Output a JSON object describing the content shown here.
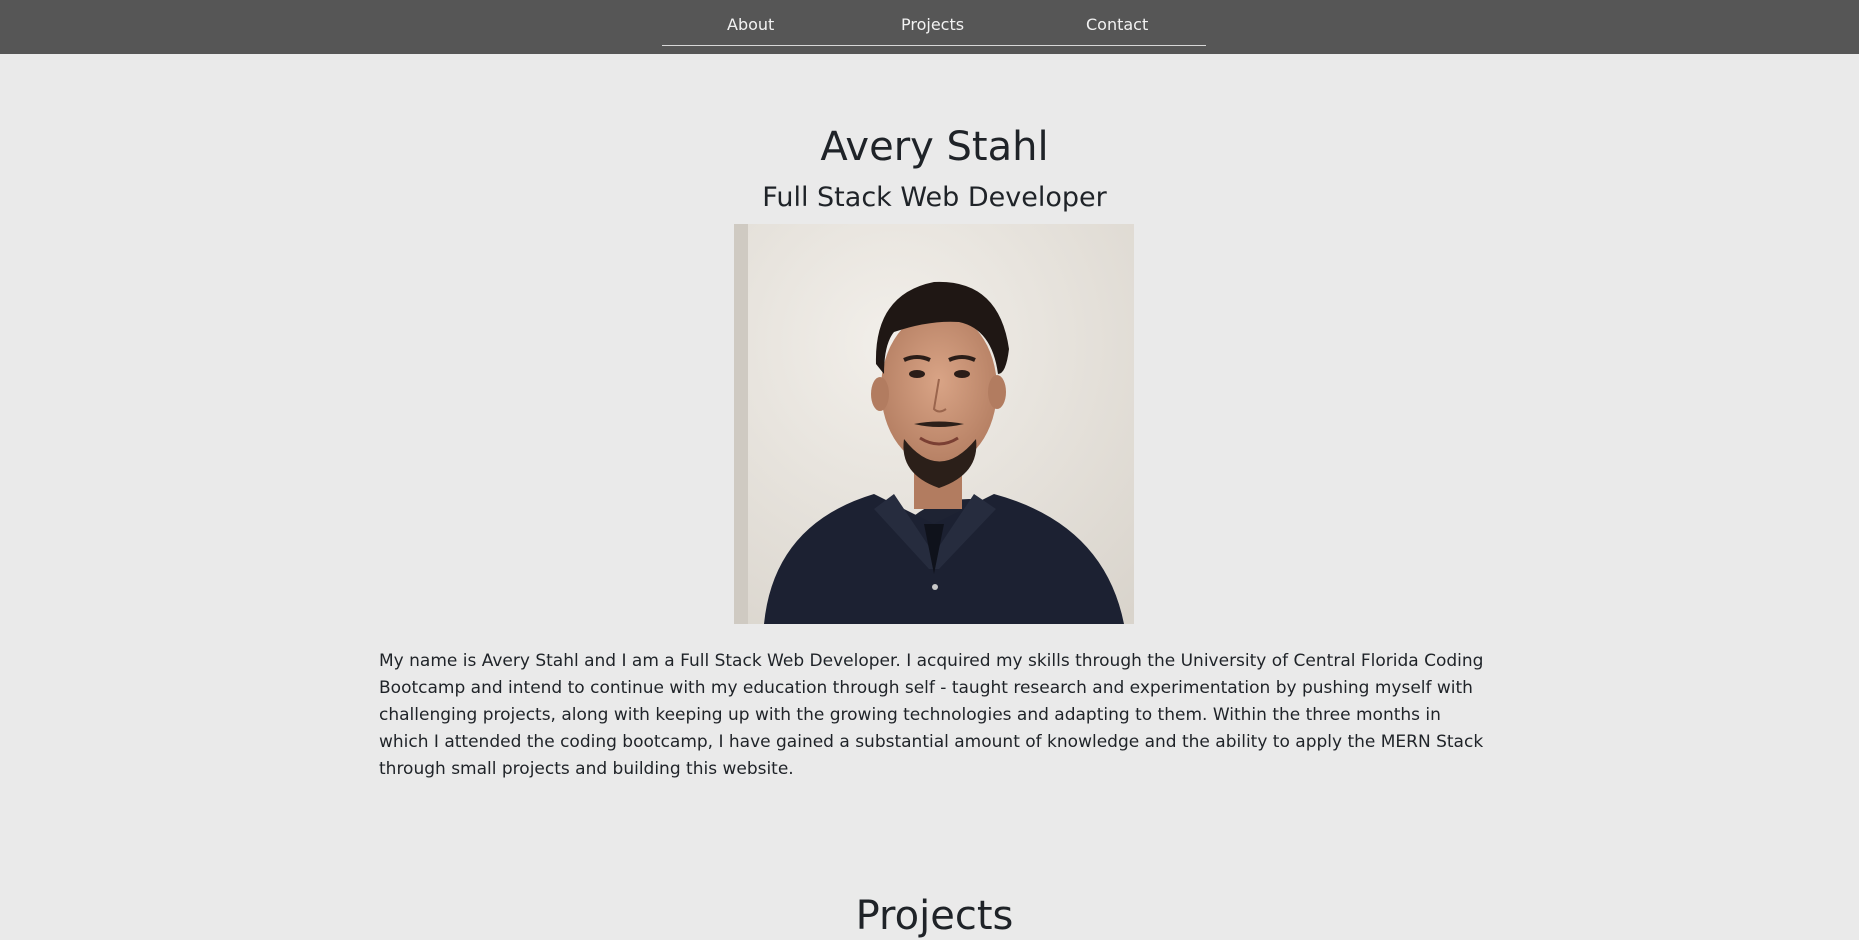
{
  "nav": {
    "links": [
      {
        "label": "About"
      },
      {
        "label": "Projects"
      },
      {
        "label": "Contact"
      }
    ]
  },
  "hero": {
    "name": "Avery Stahl",
    "role": "Full Stack Web Developer",
    "photo_alt": "Portrait of Avery Stahl"
  },
  "about": {
    "bio": "My name is Avery Stahl and I am a Full Stack Web Developer. I acquired my skills through the University of Central Florida Coding Bootcamp and intend to continue with my education through self - taught research and experimentation by pushing myself with challenging projects, along with keeping up with the growing technologies and adapting to them. Within the three months in which I attended the coding bootcamp, I have gained a substantial amount of knowledge and the ability to apply the MERN Stack through small projects and building this website."
  },
  "projects": {
    "title": "Projects"
  },
  "colors": {
    "navbar": "#565656",
    "background": "#eaeaea",
    "text": "#1f2328",
    "nav_text": "#f2f2f2"
  }
}
